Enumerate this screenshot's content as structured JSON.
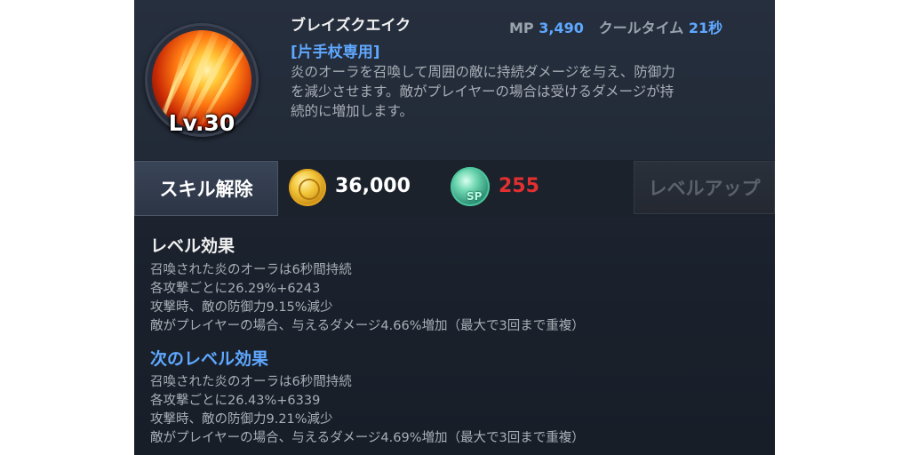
{
  "skill": {
    "name": "ブレイズクエイク",
    "level": "Lv.30",
    "mp_label": "MP",
    "mp_value": "3,490",
    "cooldown_label": "クールタイム",
    "cooldown_value": "21秒",
    "restriction": "[片手杖専用]",
    "description": [
      "炎のオーラを召喚して周囲の敵に持続ダメージを与え、防御力",
      "を減少させます。敵がプレイヤーの場合は受けるダメージが持",
      "続的に増加します。"
    ],
    "icon": "fire-skill-icon"
  },
  "actions": {
    "release_label": "スキル解除",
    "gold_icon": "gold-coin-icon",
    "gold_amount": "36,000",
    "sp_icon": "sp-orb-icon",
    "sp_label": "SP",
    "sp_amount": "255",
    "levelup_label": "レベルアップ",
    "levelup_enabled": false
  },
  "current_effects": {
    "title": "レベル効果",
    "lines": [
      "召喚された炎のオーラは6秒間持続",
      "各攻撃ごとに26.29%+6243",
      "攻撃時、敵の防御力9.15%減少",
      "敵がプレイヤーの場合、与えるダメージ4.66%増加（最大で3回まで重複）"
    ]
  },
  "next_effects": {
    "title": "次のレベル効果",
    "lines": [
      "召喚された炎のオーラは6秒間持続",
      "各攻撃ごとに26.43%+6339",
      "攻撃時、敵の防御力9.21%減少",
      "敵がプレイヤーの場合、与えるダメージ4.69%増加（最大で3回まで重複）"
    ]
  },
  "colors": {
    "accent_blue": "#5fa8ff",
    "sp_red": "#e23030",
    "panel_bg": "#1f2733"
  }
}
